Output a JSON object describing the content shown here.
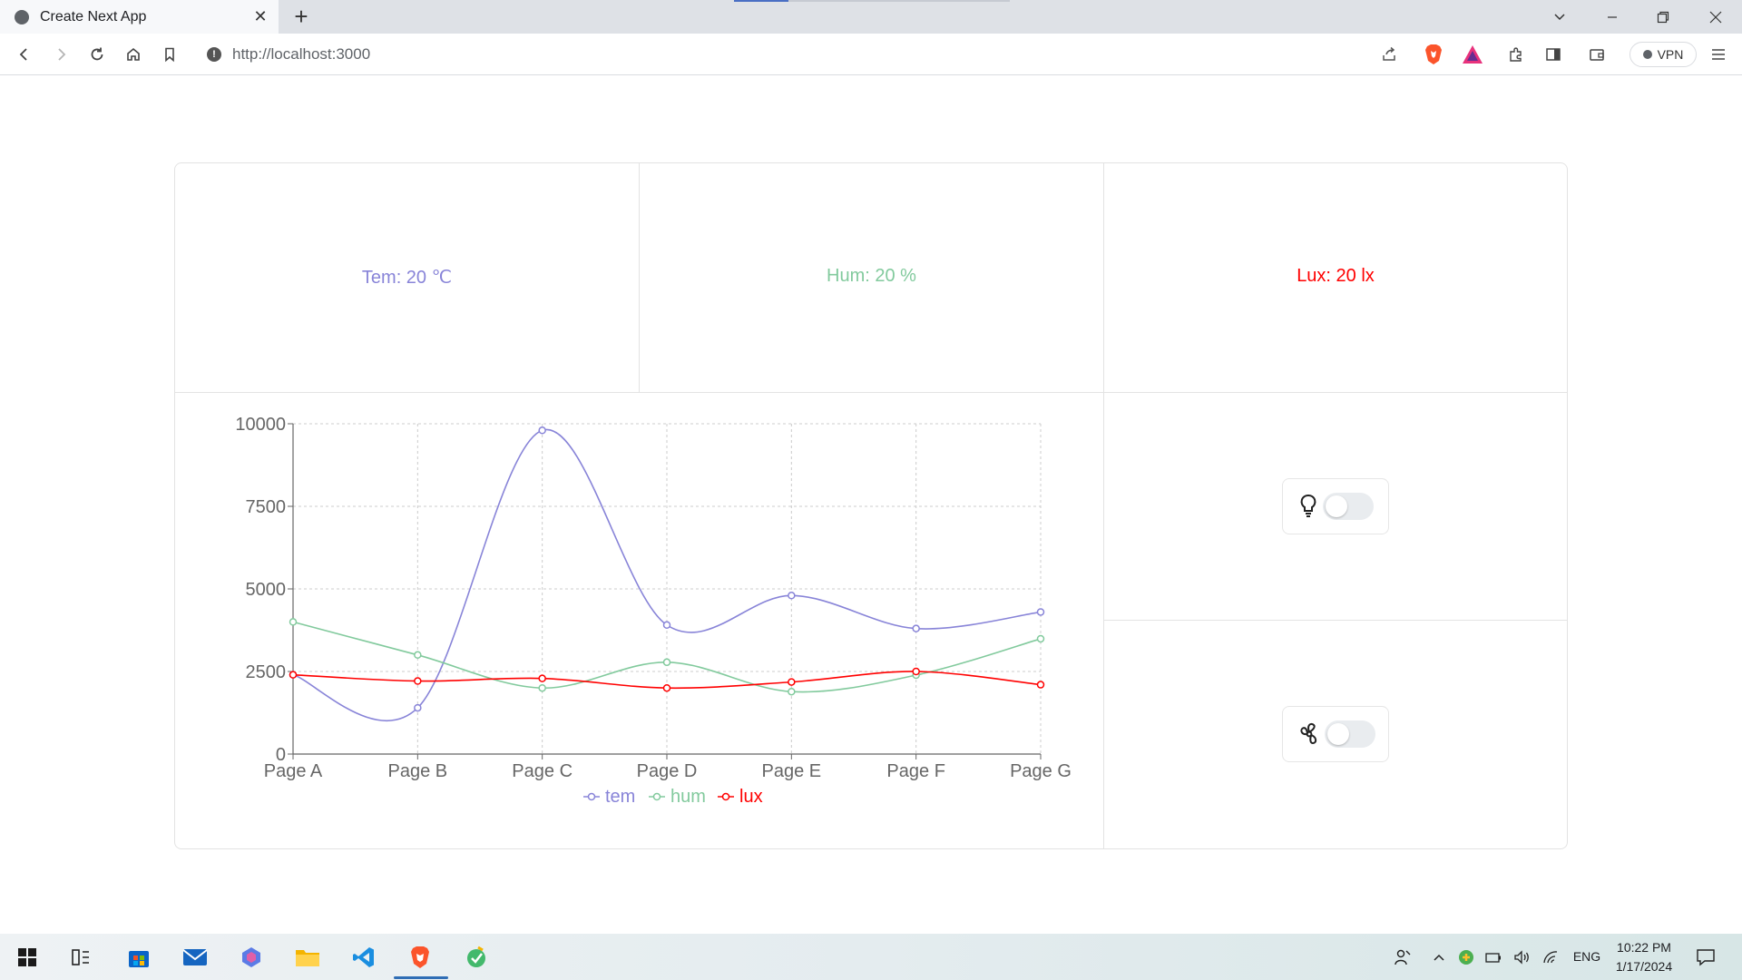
{
  "browser": {
    "tab_title": "Create Next App",
    "tab_close": "✕",
    "new_tab": "+",
    "url": "http://localhost:3000",
    "vpn_label": "VPN"
  },
  "stats": {
    "tem": "Tem: 20 ℃",
    "hum": "Hum: 20 %",
    "lux": "Lux: 20 lx"
  },
  "devices": {
    "light_icon": "lightbulb-icon",
    "light_on": false,
    "fan_icon": "fan-icon",
    "fan_on": false
  },
  "colors": {
    "tem": "#8884d8",
    "hum": "#82ca9d",
    "lux": "#ff0000"
  },
  "chart_data": {
    "type": "line",
    "categories": [
      "Page A",
      "Page B",
      "Page C",
      "Page D",
      "Page E",
      "Page F",
      "Page G"
    ],
    "series": [
      {
        "name": "tem",
        "color": "#8884d8",
        "values": [
          2400,
          1398,
          9800,
          3908,
          4800,
          3800,
          4300
        ]
      },
      {
        "name": "hum",
        "color": "#82ca9d",
        "values": [
          4000,
          3000,
          2000,
          2780,
          1890,
          2390,
          3490
        ]
      },
      {
        "name": "lux",
        "color": "#ff0000",
        "values": [
          2400,
          2210,
          2290,
          2000,
          2181,
          2500,
          2100
        ]
      }
    ],
    "yticks": [
      0,
      2500,
      5000,
      7500,
      10000
    ],
    "ylim": [
      0,
      10000
    ],
    "grid": true,
    "legend_position": "bottom"
  },
  "taskbar": {
    "lang": "ENG",
    "time": "10:22 PM",
    "date": "1/17/2024"
  }
}
